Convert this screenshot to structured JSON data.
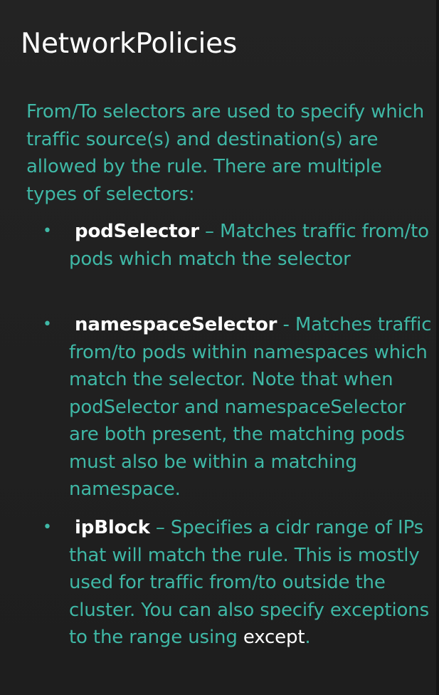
{
  "slide": {
    "title": "NetworkPolicies",
    "intro": "From/To selectors are used to specify which traffic source(s) and destination(s) are allowed by the rule. There are multiple types of selectors:",
    "bullets": [
      {
        "marker": "•",
        "term": "podSelector",
        "separator": " – ",
        "description": "Matches traffic from/to pods which match the selector"
      },
      {
        "marker": "•",
        "term": "namespaceSelector",
        "separator": " - ",
        "description": "Matches traffic from/to pods within namespaces which match the selector. Note that when podSelector and namespaceSelector are both present, the matching pods must also be within a matching namespace."
      },
      {
        "marker": "•",
        "term": "ipBlock",
        "separator": " – ",
        "description": "Specifies a cidr range of IPs that will match the rule. This is mostly used for traffic from/to outside the cluster. You can also specify exceptions to the range using ",
        "highlight": "except",
        "ending": "."
      }
    ]
  },
  "colors": {
    "background": "#1f1f1f",
    "title": "#ffffff",
    "accent": "#3fb8a6",
    "term": "#ffffff"
  }
}
